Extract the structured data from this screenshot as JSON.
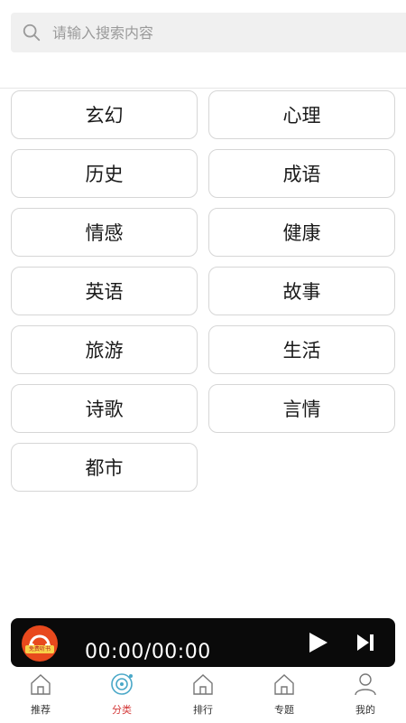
{
  "search": {
    "placeholder": "请输入搜索内容"
  },
  "categories": [
    "玄幻",
    "心理",
    "历史",
    "成语",
    "情感",
    "健康",
    "英语",
    "故事",
    "旅游",
    "生活",
    "诗歌",
    "言情",
    "都市"
  ],
  "player": {
    "time": "00:00/00:00",
    "album_badge": "免费听书"
  },
  "tabs": [
    {
      "label": "推荐",
      "icon": "home-icon"
    },
    {
      "label": "分类",
      "icon": "disc-icon",
      "active": true
    },
    {
      "label": "排行",
      "icon": "home-icon"
    },
    {
      "label": "专题",
      "icon": "home-icon"
    },
    {
      "label": "我的",
      "icon": "user-icon"
    }
  ],
  "colors": {
    "accent": "#d43a3a",
    "player_bg": "#0a0a0a",
    "active_icon": "#4aa8c8"
  }
}
